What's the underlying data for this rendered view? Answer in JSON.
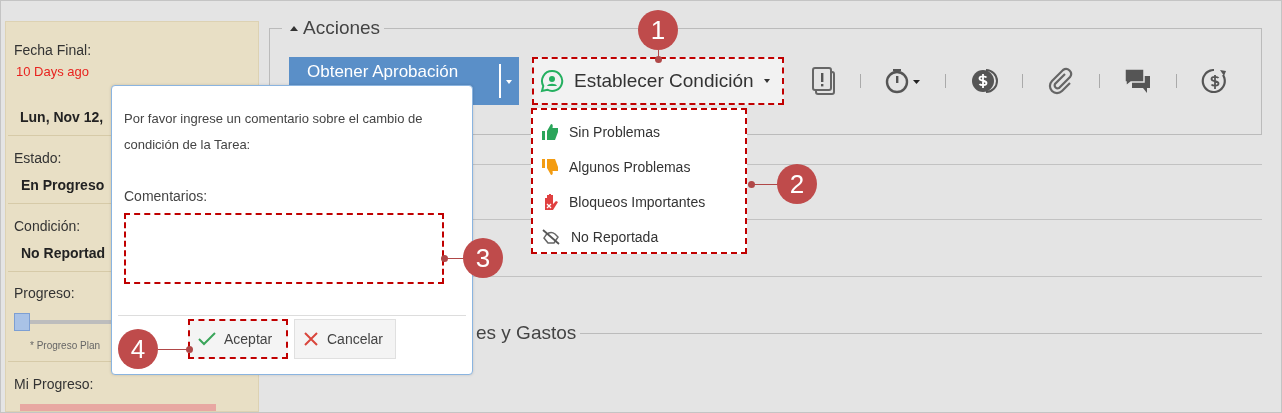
{
  "sidebar": {
    "due_label": "Fecha Final:",
    "due_relative": "10 Days ago",
    "due_date": "Lun, Nov 12,",
    "status_label": "Estado:",
    "status_value": "En Progreso",
    "condition_label": "Condición:",
    "condition_value": "No Reportad",
    "progress_label": "Progreso:",
    "progress": {
      "level": 0
    },
    "progress_note": "* Progreso Plan",
    "my_progress_label": "Mi Progreso:"
  },
  "actions": {
    "legend": "Acciones",
    "expanded": true,
    "approve_button": "Obtener Aprobación",
    "condition_button": "Establecer Condición",
    "condition_menu": [
      {
        "label": "Sin Problemas",
        "kind": "good"
      },
      {
        "label": "Algunos Problemas",
        "kind": "some"
      },
      {
        "label": "Bloqueos Importantes",
        "kind": "blocked"
      },
      {
        "label": "No Reportada",
        "kind": "none"
      }
    ],
    "toolbar": [
      {
        "kind": "issues"
      },
      {
        "kind": "timer"
      },
      {
        "kind": "cost"
      },
      {
        "kind": "attach"
      },
      {
        "kind": "chat"
      },
      {
        "kind": "refund"
      }
    ]
  },
  "section": {
    "legend": "es y Gastos"
  },
  "dialog": {
    "message": "Por favor ingrese un comentario sobre el cambio de condición de la Tarea:",
    "comments_label": "Comentarios:",
    "buttons": [
      {
        "label": "Aceptar",
        "kind": "ok"
      },
      {
        "label": "Cancelar",
        "kind": "cancel"
      }
    ]
  },
  "callouts": [
    "1",
    "2",
    "3",
    "4"
  ]
}
